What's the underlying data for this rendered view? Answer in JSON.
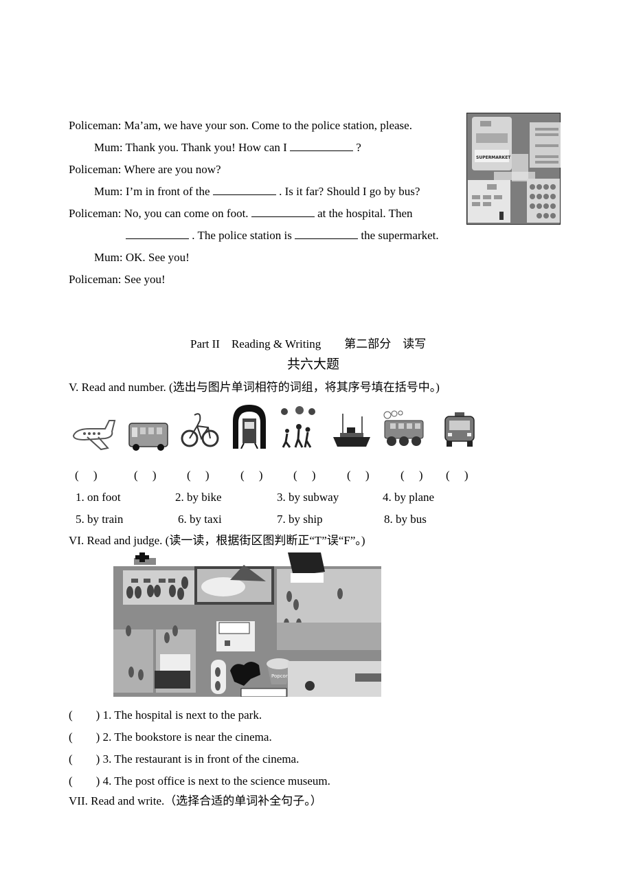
{
  "dialogue": [
    {
      "speaker": "Policeman:",
      "parts": [
        "Ma’am, we have your son. Come to the police station, please."
      ]
    },
    {
      "speaker": "Mum:",
      "parts": [
        "Thank you. Thank you! How can I",
        "?"
      ]
    },
    {
      "speaker": "Policeman:",
      "parts": [
        "Where are you now?"
      ]
    },
    {
      "speaker": "Mum:",
      "parts": [
        "I’m in front of the",
        ". Is it far? Should I go by bus?"
      ]
    },
    {
      "speaker": "Policeman:",
      "parts": [
        "No, you can come on foot.",
        "at the hospital. Then"
      ]
    },
    {
      "speaker": "",
      "parts": [
        ". The police station is",
        "the supermarket."
      ]
    },
    {
      "speaker": "Mum:",
      "parts": [
        "OK. See you!"
      ]
    },
    {
      "speaker": "Policeman:",
      "parts": [
        "See you!"
      ]
    }
  ],
  "map_small": {
    "icon": "street-map-image",
    "label": "SUPERMARKET"
  },
  "part2": {
    "title": "Part II　Reading & Writing　　第二部分　读写",
    "subtitle": "共六大题"
  },
  "section5": {
    "heading": "V. Read and number. (选出与图片单词相符的词组，将其序号填在括号中。)",
    "pictures": [
      "plane-icon",
      "bus-icon",
      "bike-icon",
      "subway-icon",
      "walking-icon",
      "ship-icon",
      "train-icon",
      "taxi-icon"
    ],
    "paren": "(　 )",
    "options": [
      "1. on foot",
      "2. by bike",
      "3. by subway",
      "4. by plane",
      "5. by train",
      "6. by taxi",
      "7. by ship",
      "8. by bus"
    ]
  },
  "section6": {
    "heading": "VI. Read and judge. (读一读，根据街区图判断正“T”误“F”。)",
    "map_icon": "town-map-image",
    "popcorn_label": "Popcorn",
    "paren": "(　　)",
    "items": [
      "1. The hospital is next to the park.",
      "2. The bookstore is near the cinema.",
      "3. The restaurant is in front of the cinema.",
      "4. The post office is next to the science museum."
    ]
  },
  "section7": {
    "heading": "VII. Read and write.（选择合适的单词补全句子。）"
  }
}
